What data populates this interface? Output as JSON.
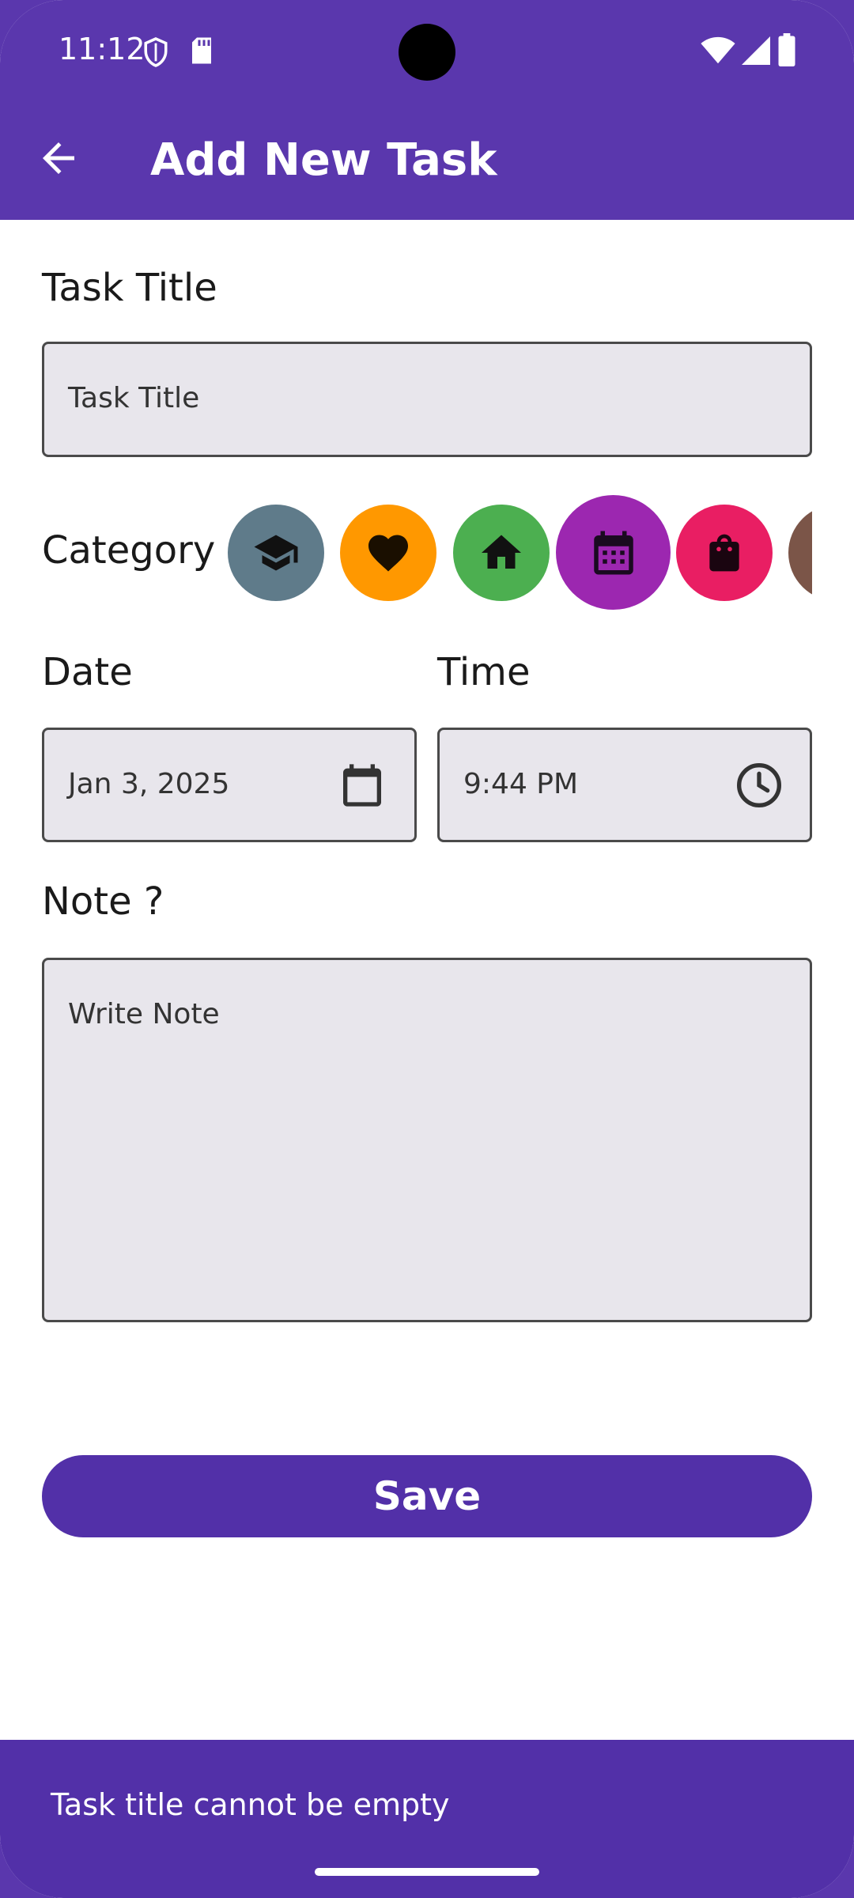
{
  "status_bar": {
    "time": "11:12"
  },
  "app_bar": {
    "title": "Add New Task"
  },
  "form": {
    "task_title_label": "Task Title",
    "task_title_placeholder": "Task Title",
    "category_label": "Category",
    "categories": [
      {
        "icon": "graduation-cap-icon",
        "color": "#5f7b8a"
      },
      {
        "icon": "heart-icon",
        "color": "#ff9800"
      },
      {
        "icon": "home-icon",
        "color": "#4caf50"
      },
      {
        "icon": "calendar-icon",
        "color": "#9c27b0",
        "selected": true
      },
      {
        "icon": "shopping-bag-icon",
        "color": "#e91e63"
      },
      {
        "icon": "category-icon",
        "color": "#7b5548"
      }
    ],
    "date_label": "Date",
    "date_value": "Jan 3, 2025",
    "time_label": "Time",
    "time_value": "9:44 PM",
    "note_label": "Note ?",
    "note_placeholder": "Write Note",
    "save_label": "Save"
  },
  "snackbar": {
    "message": "Task title cannot be empty"
  },
  "colors": {
    "primary": "#5a37ad",
    "button": "#5230a8",
    "field_bg": "#e8e6ec"
  }
}
